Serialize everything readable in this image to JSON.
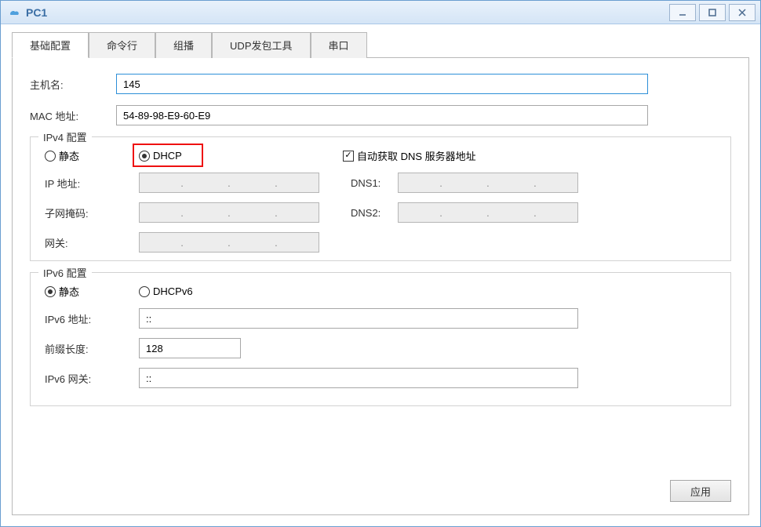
{
  "titlebar": {
    "title": "PC1"
  },
  "tabs": [
    {
      "label": "基础配置",
      "active": true
    },
    {
      "label": "命令行",
      "active": false
    },
    {
      "label": "组播",
      "active": false
    },
    {
      "label": "UDP发包工具",
      "active": false
    },
    {
      "label": "串口",
      "active": false
    }
  ],
  "basic": {
    "hostname_label": "主机名:",
    "hostname_value": "145",
    "mac_label": "MAC 地址:",
    "mac_value": "54-89-98-E9-60-E9"
  },
  "ipv4": {
    "legend": "IPv4 配置",
    "static_label": "静态",
    "dhcp_label": "DHCP",
    "dhcp_selected": true,
    "auto_dns_label": "自动获取 DNS 服务器地址",
    "auto_dns_checked": true,
    "ip_label": "IP 地址:",
    "mask_label": "子网掩码:",
    "gw_label": "网关:",
    "dns1_label": "DNS1:",
    "dns2_label": "DNS2:"
  },
  "ipv6": {
    "legend": "IPv6 配置",
    "static_label": "静态",
    "dhcpv6_label": "DHCPv6",
    "static_selected": true,
    "addr_label": "IPv6 地址:",
    "addr_value": "::",
    "prefix_label": "前缀长度:",
    "prefix_value": "128",
    "gw_label": "IPv6 网关:",
    "gw_value": "::"
  },
  "buttons": {
    "apply": "应用"
  }
}
